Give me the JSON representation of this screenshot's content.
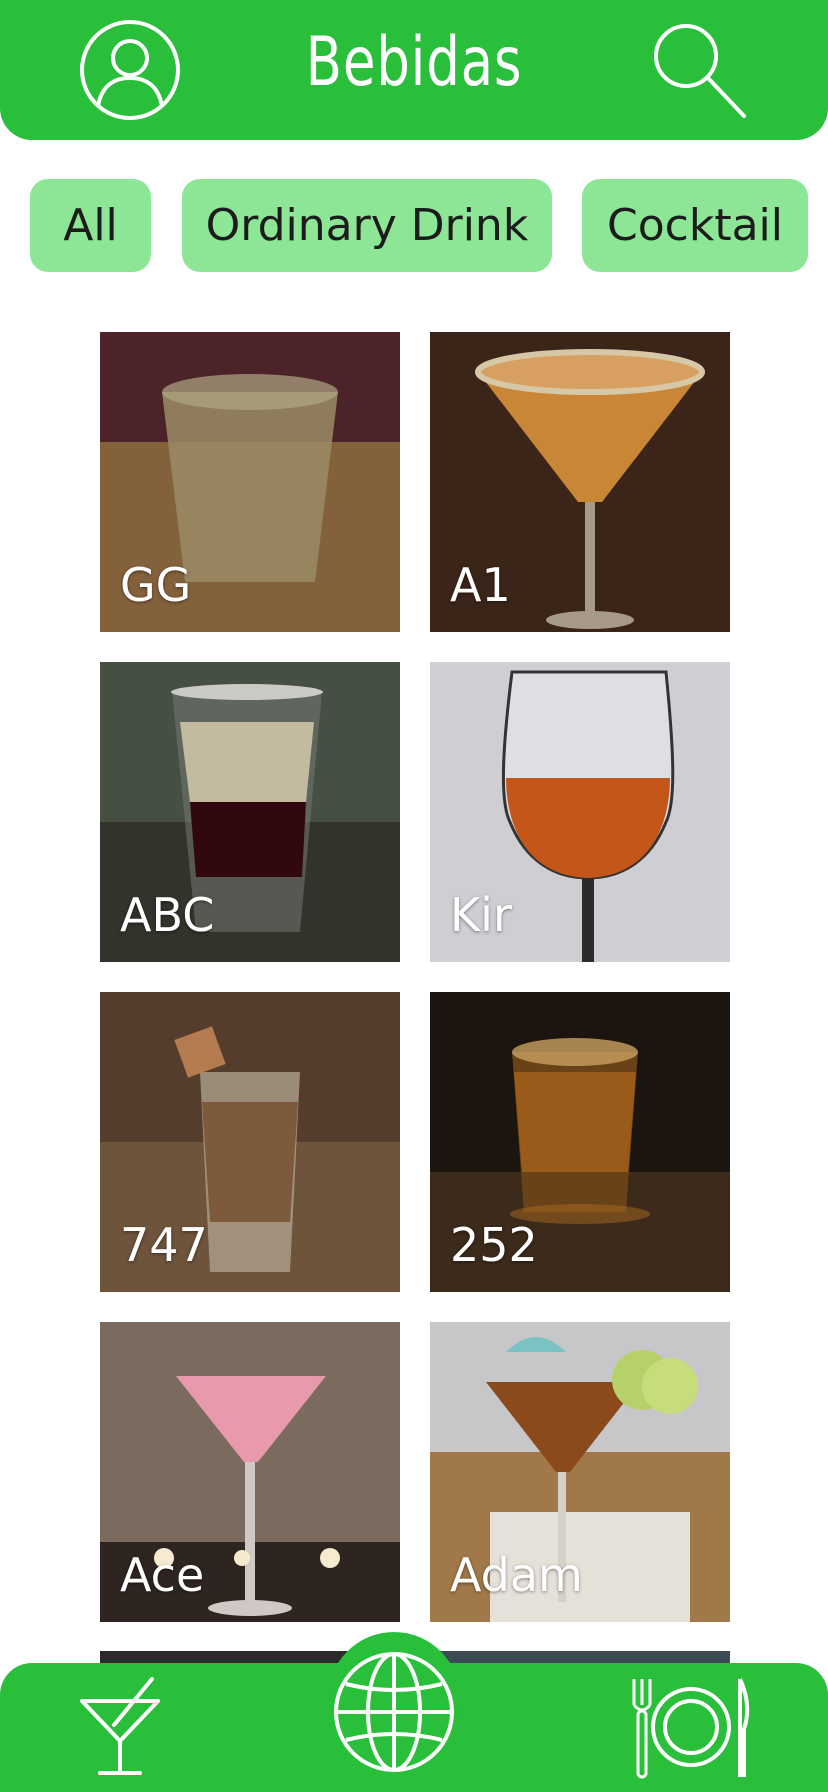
{
  "header": {
    "title": "Bebidas",
    "profile_icon": "user-icon",
    "search_icon": "search-icon"
  },
  "filters": [
    "All",
    "Ordinary Drink",
    "Cocktail"
  ],
  "drinks": [
    {
      "name": "GG"
    },
    {
      "name": "A1"
    },
    {
      "name": "ABC"
    },
    {
      "name": "Kir"
    },
    {
      "name": "747"
    },
    {
      "name": "252"
    },
    {
      "name": "Ace"
    },
    {
      "name": "Adam"
    }
  ],
  "bottom_nav": {
    "items": [
      "cocktail-icon",
      "globe-icon",
      "restaurant-icon"
    ]
  },
  "colors": {
    "primary": "#2abf3a",
    "chip": "#8de596"
  }
}
